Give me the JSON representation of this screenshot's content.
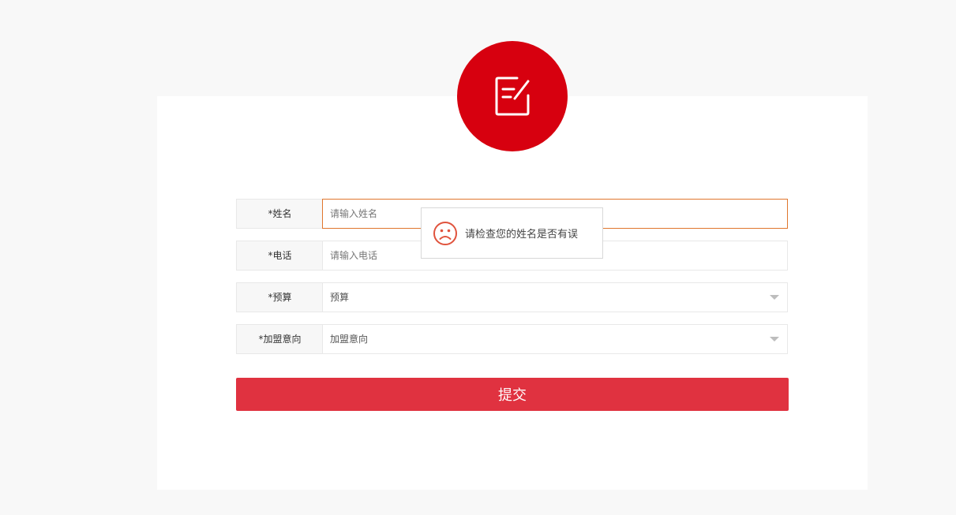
{
  "header": {
    "badge_icon": "edit-form-icon",
    "badge_color": "#d7000f"
  },
  "form": {
    "fields": [
      {
        "label": "*姓名",
        "placeholder": "请输入姓名",
        "value": ""
      },
      {
        "label": "*电话",
        "placeholder": "请输入电话",
        "value": ""
      },
      {
        "label": "*预算",
        "selected": "预算"
      },
      {
        "label": "*加盟意向",
        "selected": "加盟意向"
      }
    ],
    "submit_label": "提交",
    "submit_color": "#e03240"
  },
  "tooltip": {
    "icon": "sad-face-icon",
    "message": "请检查您的姓名是否有误"
  }
}
